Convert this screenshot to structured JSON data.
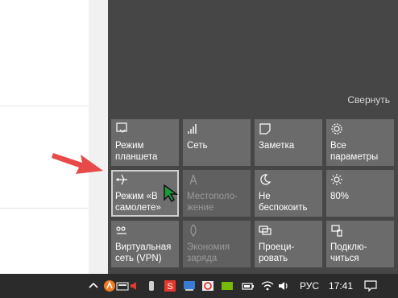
{
  "action_center": {
    "collapse_label": "Свернуть",
    "tiles": [
      {
        "name": "tile-tablet-mode",
        "label": "Режим планшета",
        "icon": "tablet-mode-icon",
        "disabled": false
      },
      {
        "name": "tile-network",
        "label": "Сеть",
        "icon": "network-icon",
        "disabled": false
      },
      {
        "name": "tile-note",
        "label": "Заметка",
        "icon": "note-icon",
        "disabled": false
      },
      {
        "name": "tile-all-settings",
        "label": "Все параметры",
        "icon": "gear-icon",
        "disabled": false
      },
      {
        "name": "tile-airplane-mode",
        "label": "Режим «В самолете»",
        "icon": "airplane-icon",
        "disabled": false,
        "focused": true
      },
      {
        "name": "tile-location",
        "label": "Местополо-жение",
        "icon": "location-icon",
        "disabled": true
      },
      {
        "name": "tile-quiet-hours",
        "label": "Не беспокоить",
        "icon": "moon-icon",
        "disabled": false
      },
      {
        "name": "tile-brightness",
        "label": "80%",
        "icon": "brightness-icon",
        "disabled": false
      },
      {
        "name": "tile-vpn",
        "label": "Виртуальная сеть (VPN)",
        "icon": "vpn-icon",
        "disabled": false
      },
      {
        "name": "tile-battery-saver",
        "label": "Экономия заряда",
        "icon": "battery-saver-icon",
        "disabled": true
      },
      {
        "name": "tile-project",
        "label": "Проеци-ровать",
        "icon": "project-icon",
        "disabled": false
      },
      {
        "name": "tile-connect",
        "label": "Подклю-читься",
        "icon": "connect-icon",
        "disabled": false
      }
    ]
  },
  "taskbar": {
    "language": "РУС",
    "time": "17:41"
  },
  "colors": {
    "panel_bg": "#464646",
    "tile_bg": "#6b6b6b",
    "taskbar_bg": "#2b2b2b",
    "annotation_arrow": "#e84a4a"
  }
}
